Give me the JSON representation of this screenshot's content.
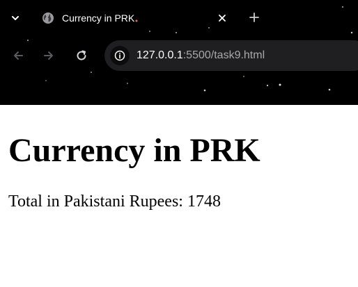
{
  "browser": {
    "tab": {
      "title": "Currency in PRK",
      "favicon_icon": "globe-icon",
      "close_icon": "close-icon"
    },
    "tab_search_icon": "chevron-down-icon",
    "new_tab_icon": "plus-icon",
    "nav": {
      "back_icon": "arrow-left-icon",
      "forward_icon": "arrow-right-icon",
      "reload_icon": "reload-icon"
    },
    "address_bar": {
      "site_info_icon": "info-icon",
      "host": "127.0.0.1",
      "path": ":5500/task9.html"
    },
    "colors": {
      "chrome_background": "#000000",
      "omnibox_background": "#1f1f22",
      "url_path": "#a8a8ad"
    }
  },
  "page": {
    "heading": "Currency in PRK",
    "total_line": "Total in Pakistani Rupees: 1748"
  }
}
